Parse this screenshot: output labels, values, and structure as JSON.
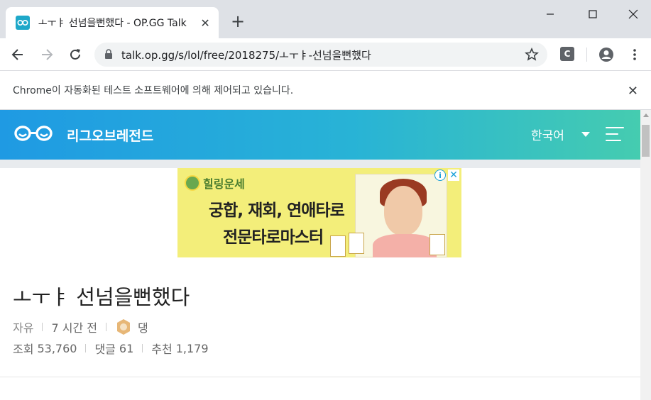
{
  "browser": {
    "tab_title": "ㅗㅜㅑ 선넘을뻔했다 - OP.GG Talk",
    "url": "talk.op.gg/s/lol/free/2018275/ㅗㅜㅑ-선넘을뻔했다",
    "extension_label": "C",
    "infobar_text": "Chrome이 자동화된 테스트 소프트웨어에 의해 제어되고 있습니다."
  },
  "site": {
    "brand": "리그오브레전드",
    "language": "한국어",
    "brand_color": "#1f9ae3",
    "accent_color": "#45ccb0"
  },
  "ad": {
    "brand": "힐링운세",
    "line1": "궁합, 재회, 연애타로",
    "line2": "전문타로마스터"
  },
  "post": {
    "title": "ㅗㅜㅑ 선넘을뻔했다",
    "category": "자유",
    "time": "7 시간 전",
    "author": "댕",
    "views_label": "조회",
    "views": "53,760",
    "comments_label": "댓글",
    "comments": "61",
    "likes_label": "추천",
    "likes": "1,179"
  }
}
